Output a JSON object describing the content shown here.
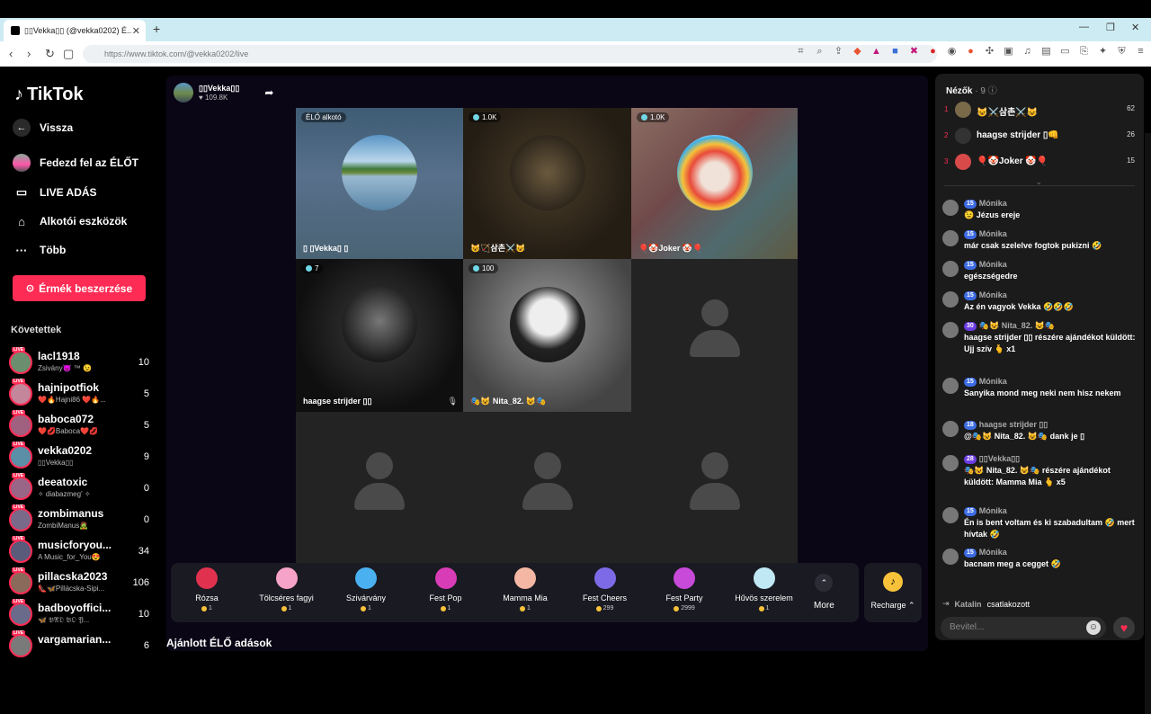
{
  "browser": {
    "tab_title": "▯▯Vekka▯▯ (@vekka0202) É...",
    "new_tab": "+",
    "url": "https://www.tiktok.com/@vekka0202/live"
  },
  "sidebar": {
    "logo": "TikTok",
    "back": "Vissza",
    "explore_live": "Fedezd fel az ÉLŐT",
    "live_studio": "LIVE ADÁS",
    "creator_tools": "Alkotói eszközök",
    "more": "Több",
    "coin_button": "Érmék beszerzése",
    "following_title": "Követettek",
    "following": [
      {
        "name": "lacl1918",
        "sub": "Zsivány😈 ™ 😉",
        "count": "10"
      },
      {
        "name": "hajnipotfiok",
        "sub": "❤️🔥Hajni86 ❤️🔥...",
        "count": "5"
      },
      {
        "name": "baboca072",
        "sub": "❤️💋Baboca❤️💋",
        "count": "5"
      },
      {
        "name": "vekka0202",
        "sub": "▯▯Vekka▯▯",
        "count": "9"
      },
      {
        "name": "deeatoxic",
        "sub": "✧ diabazmeg' ✧",
        "count": "0"
      },
      {
        "name": "zombimanus",
        "sub": "ZombiManus🧟",
        "count": "0"
      },
      {
        "name": "musicforyou...",
        "sub": "A Music_for_You😍",
        "count": "34"
      },
      {
        "name": "pillacska2023",
        "sub": "👠🦋Pillácska-Sipi...",
        "count": "106"
      },
      {
        "name": "badboyoffici...",
        "sub": "🦋 𝔅𝔄𝔇 𝔅𝔒 𝔜...",
        "count": "10"
      },
      {
        "name": "vargamarian...",
        "sub": "",
        "count": "6"
      }
    ]
  },
  "stage": {
    "host_name": "▯▯Vekka▯▯",
    "host_likes": "♥ 109.8K",
    "cells": [
      {
        "badge": "ÉLŐ alkotó",
        "name": "▯ ▯Vekka▯ ▯"
      },
      {
        "badge": "1.0K",
        "name": "😺🏹삼촌⚔️😺"
      },
      {
        "badge": "1.0K",
        "name": "🎈🤡Joker 🤡🎈"
      },
      {
        "badge": "7",
        "name": "haagse strijder ▯▯"
      },
      {
        "badge": "100",
        "name": "🎭😺 Nita_82. 😺🎭"
      }
    ],
    "recommended": "Ajánlott ÉLŐ adások"
  },
  "gifts": [
    {
      "name": "Rózsa",
      "price": "1",
      "color": "#e0314f"
    },
    {
      "name": "Tölcséres fagyi",
      "price": "1",
      "color": "#f5a3c8"
    },
    {
      "name": "Szivárvány",
      "price": "1",
      "color": "#4ab0f0"
    },
    {
      "name": "Fest Pop",
      "price": "1",
      "color": "#d93cb7"
    },
    {
      "name": "Mamma Mia",
      "price": "1",
      "color": "#f4b7a4"
    },
    {
      "name": "Fest Cheers",
      "price": "299",
      "color": "#7d6ae6"
    },
    {
      "name": "Fest Party",
      "price": "2999",
      "color": "#c84ad8"
    },
    {
      "name": "Hűvös szerelem",
      "price": "1",
      "color": "#bfe8f4"
    }
  ],
  "more_label": "More",
  "recharge_label": "Recharge ⌃",
  "viewers": {
    "title": "Nézők",
    "count": "· 9",
    "list": [
      {
        "rank": "1",
        "name": "😺⚔️삼촌⚔️😺",
        "score": "62"
      },
      {
        "rank": "2",
        "name": "haagse strijder ▯👊",
        "score": "26"
      },
      {
        "rank": "3",
        "name": "🎈🤡Joker 🤡🎈",
        "score": "15"
      }
    ]
  },
  "chat": [
    {
      "user": "Mónika",
      "level": "15",
      "text": "😉 Jézus ereje"
    },
    {
      "user": "Mónika",
      "level": "15",
      "text": "már csak szelelve fogtok pukizni 🤣"
    },
    {
      "user": "Mónika",
      "level": "15",
      "text": "egészségedre"
    },
    {
      "user": "Mónika",
      "level": "15",
      "text": "Az én vagyok Vekka 🤣🤣🤣"
    },
    {
      "user": "🎭😺 Nita_82. 😺🎭",
      "level": "30",
      "text": "haagse strijder ▯▯ részére ajándékot küldött: Ujj szív 🫰 x1"
    },
    {
      "user": "Mónika",
      "level": "15",
      "text": "Sanyika mond meg neki nem hisz nekem"
    },
    {
      "user": "haagse strijder ▯▯",
      "level": "18",
      "text": "@🎭😺 Nita_82. 😺🎭 dank je ▯"
    },
    {
      "user": "▯▯Vekka▯▯",
      "level": "28",
      "text": "🎭😺 Nita_82. 😺🎭 részére ajándékot küldött: Mamma Mia 🫰 x5"
    },
    {
      "user": "Mónika",
      "level": "15",
      "text": "Én is bent voltam és ki szabadultam 🤣 mert hívtak 🤣"
    },
    {
      "user": "Mónika",
      "level": "15",
      "text": "bacnam meg a cegget 🤣"
    }
  ],
  "joined": {
    "user": "Katalin",
    "text": "csatlakozott"
  },
  "input_placeholder": "Bevitel...",
  "colors": {
    "accent": "#fe2c55",
    "stage_bg": "#0a0615"
  }
}
